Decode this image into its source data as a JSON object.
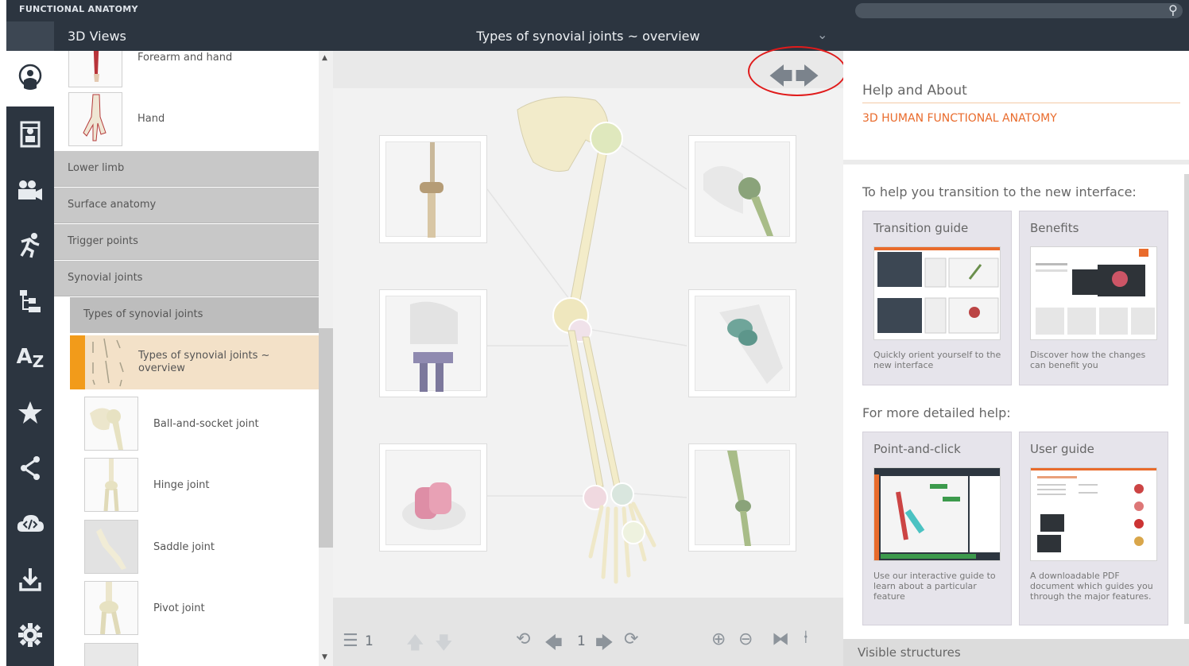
{
  "app": {
    "brand": "FUNCTIONAL ANATOMY"
  },
  "search": {
    "placeholder": ""
  },
  "rail": {
    "items": [
      "3d-views-icon",
      "atlas-icon",
      "movies-icon",
      "animations-icon",
      "hierarchy-icon",
      "a-z-icon",
      "favorites-icon",
      "share-icon",
      "embed-icon",
      "download-icon",
      "settings-icon"
    ]
  },
  "views": {
    "header": "3D Views",
    "rows": {
      "forearm": "Forearm and hand",
      "hand": "Hand",
      "lower_limb": "Lower limb",
      "surface": "Surface anatomy",
      "trigger": "Trigger points",
      "synovial": "Synovial joints",
      "types": "Types of synovial joints",
      "overview": "Types of synovial joints ~ overview",
      "ball": "Ball-and-socket joint",
      "hinge": "Hinge joint",
      "saddle": "Saddle joint",
      "pivot": "Pivot joint"
    }
  },
  "viewer": {
    "title": "Types of synovial joints ~ overview",
    "layer_count": "1",
    "view_index": "1"
  },
  "help": {
    "title": "Help and About",
    "app_name": "3D HUMAN FUNCTIONAL ANATOMY",
    "transition_heading": "To help you transition to the new interface:",
    "detailed_heading": "For more detailed help:",
    "cards": [
      {
        "title": "Transition guide",
        "desc": "Quickly orient yourself to the new interface"
      },
      {
        "title": "Benefits",
        "desc": "Discover how the changes can benefit you"
      },
      {
        "title": "Point-and-click",
        "desc": "Use our interactive guide to learn about a particular feature"
      },
      {
        "title": "User guide",
        "desc": "A downloadable PDF document which guides you through the major features."
      }
    ],
    "visible_structures": "Visible structures"
  },
  "colors": {
    "chrome": "#2c3540",
    "accent_orange": "#f29b1a",
    "help_accent": "#e96b2c",
    "selected_row": "#f3e1c8",
    "highlight_ring": "#e01b1b"
  }
}
